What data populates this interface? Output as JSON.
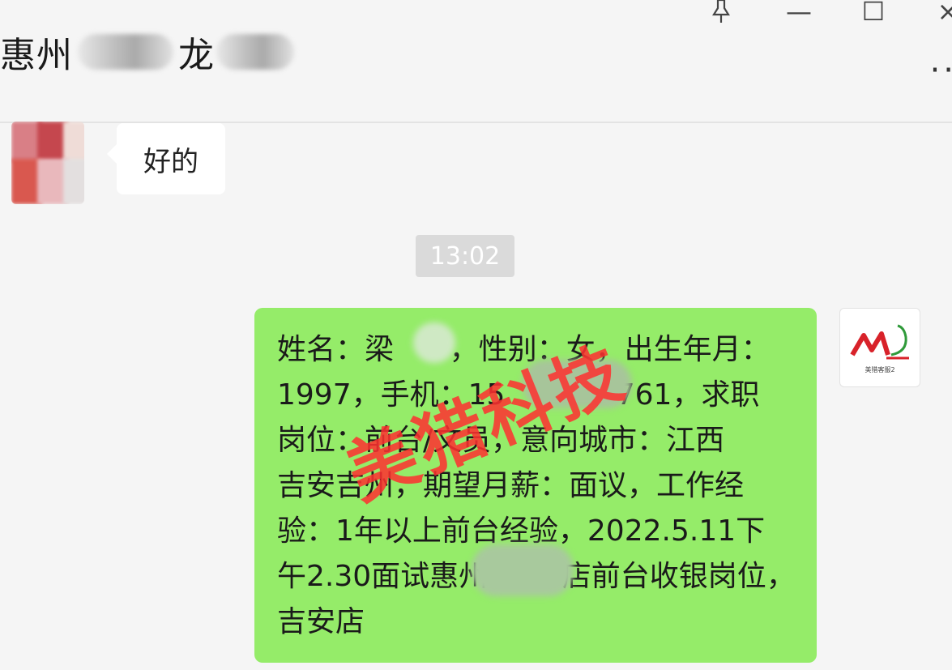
{
  "chat": {
    "title_prefix": "惠州",
    "title_middle": "龙"
  },
  "window_controls": {
    "pin_icon": "pin-icon",
    "minimize": "—",
    "maximize": "☐",
    "close": "×",
    "more": "··"
  },
  "messages": {
    "incoming": {
      "text": "好的"
    },
    "timestamp": "13:02",
    "outgoing": {
      "text": "姓名：梁      ，性别：女，出生年月：\n1997，手机：15            761，求职\n岗位：前台/文员，意向城市：江西\n吉安吉州，期望月薪：面议，工作经\n验：1年以上前台经验，2022.5.11下\n午2.30面试惠州        店前台收银岗位，\n吉安店"
    }
  },
  "watermark": "美猎科技",
  "avatar_right": {
    "logo_text": "美猎客服2"
  },
  "colors": {
    "outgoing_bubble": "#95ec69",
    "incoming_bubble": "#ffffff",
    "watermark": "#ff3030",
    "background": "#f5f5f5"
  }
}
